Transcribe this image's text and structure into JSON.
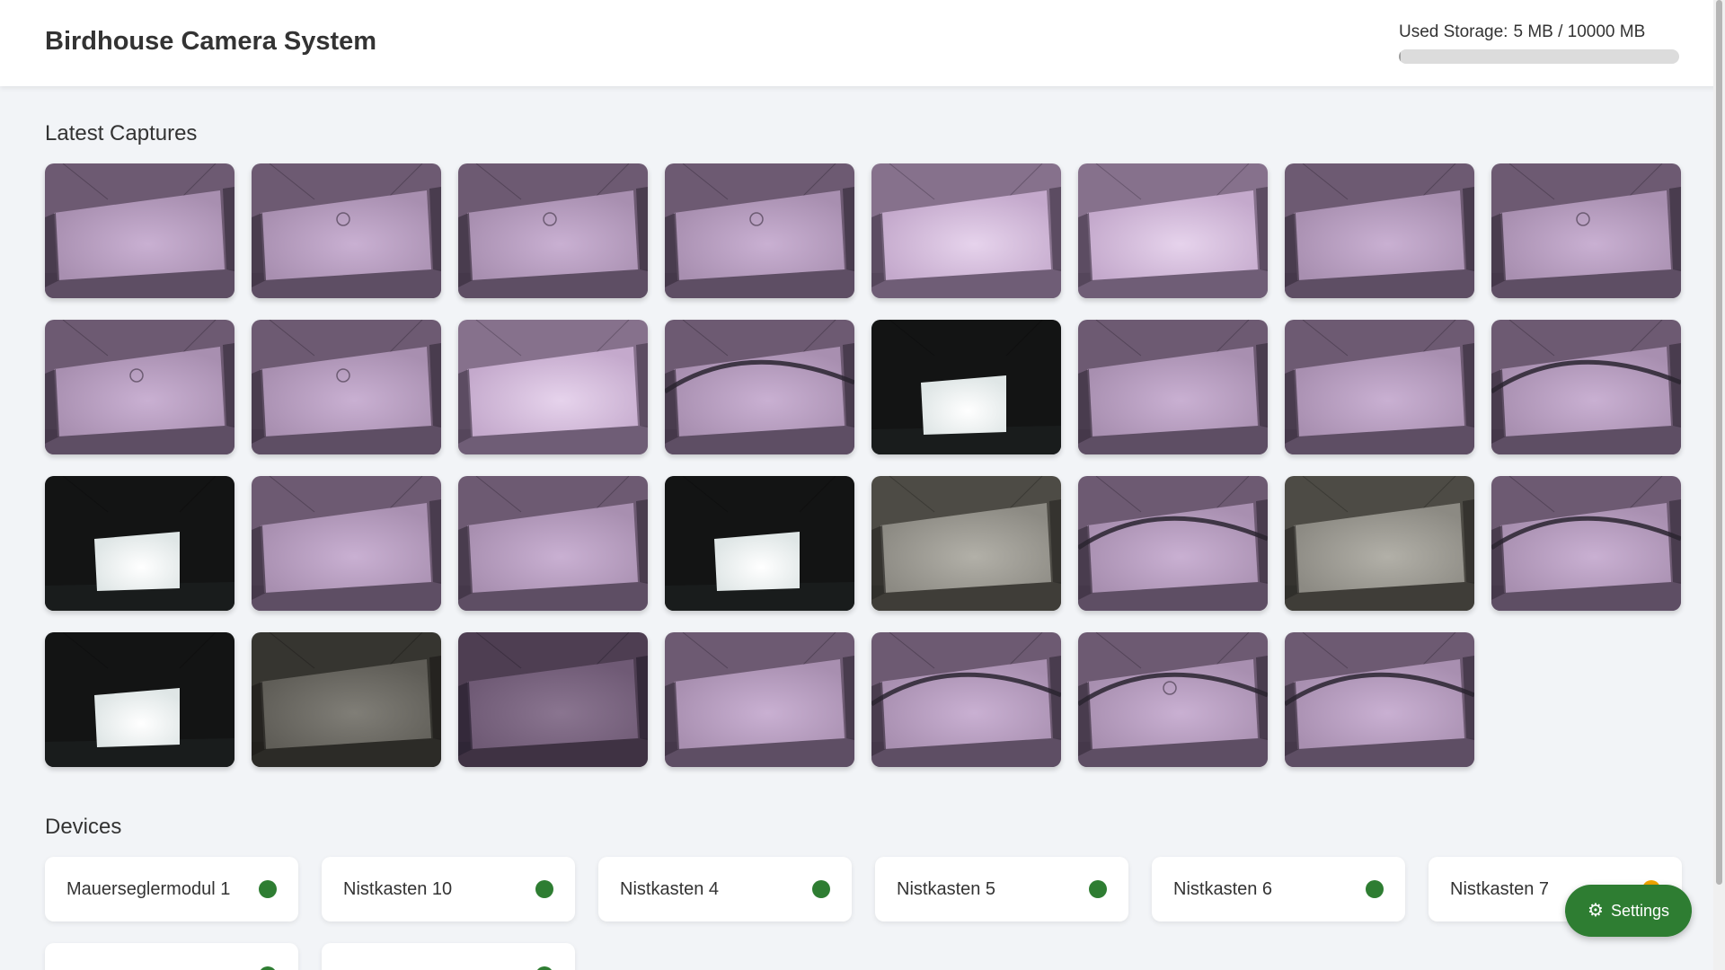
{
  "header": {
    "title": "Birdhouse Camera System",
    "storage": {
      "label": "Used Storage:",
      "value": "5 MB / 10000 MB",
      "used_mb": 5,
      "total_mb": 10000,
      "bar_color": "#9e9e9e"
    }
  },
  "captures": {
    "title": "Latest Captures",
    "items": [
      {
        "tone": "purple",
        "scene": "box"
      },
      {
        "tone": "purple",
        "scene": "box-hole"
      },
      {
        "tone": "purple",
        "scene": "box-hole"
      },
      {
        "tone": "purple",
        "scene": "box-hole"
      },
      {
        "tone": "purple-light",
        "scene": "box"
      },
      {
        "tone": "purple-light",
        "scene": "box"
      },
      {
        "tone": "purple",
        "scene": "box"
      },
      {
        "tone": "purple",
        "scene": "box-hole"
      },
      {
        "tone": "purple",
        "scene": "box-hole"
      },
      {
        "tone": "purple",
        "scene": "box-hole"
      },
      {
        "tone": "purple-light",
        "scene": "box"
      },
      {
        "tone": "purple",
        "scene": "cable"
      },
      {
        "tone": "dark-white",
        "scene": "bright"
      },
      {
        "tone": "purple",
        "scene": "box"
      },
      {
        "tone": "purple",
        "scene": "box"
      },
      {
        "tone": "purple",
        "scene": "cable"
      },
      {
        "tone": "dark-white",
        "scene": "bright"
      },
      {
        "tone": "purple",
        "scene": "box"
      },
      {
        "tone": "purple",
        "scene": "box"
      },
      {
        "tone": "dark-white",
        "scene": "bright"
      },
      {
        "tone": "gray",
        "scene": "box"
      },
      {
        "tone": "purple",
        "scene": "cable"
      },
      {
        "tone": "gray",
        "scene": "box"
      },
      {
        "tone": "purple",
        "scene": "cable"
      },
      {
        "tone": "dark-white",
        "scene": "bright"
      },
      {
        "tone": "gray-dark",
        "scene": "box"
      },
      {
        "tone": "purple-dark",
        "scene": "box"
      },
      {
        "tone": "purple",
        "scene": "box"
      },
      {
        "tone": "purple",
        "scene": "cable"
      },
      {
        "tone": "purple",
        "scene": "cable-hole"
      },
      {
        "tone": "purple",
        "scene": "cable"
      }
    ]
  },
  "devices": {
    "title": "Devices",
    "items": [
      {
        "name": "Mauerseglermodul 1",
        "status_color": "#2e7d32"
      },
      {
        "name": "Nistkasten 10",
        "status_color": "#2e7d32"
      },
      {
        "name": "Nistkasten 4",
        "status_color": "#2e7d32"
      },
      {
        "name": "Nistkasten 5",
        "status_color": "#2e7d32"
      },
      {
        "name": "Nistkasten 6",
        "status_color": "#2e7d32"
      },
      {
        "name": "Nistkasten 7",
        "status_color": "#f0a500"
      },
      {
        "name": "",
        "status_color": "#2e7d32"
      },
      {
        "name": "",
        "status_color": "#2e7d32"
      }
    ]
  },
  "settings_button": {
    "label": "Settings",
    "icon": "gear-icon",
    "color": "#2e7d32"
  }
}
